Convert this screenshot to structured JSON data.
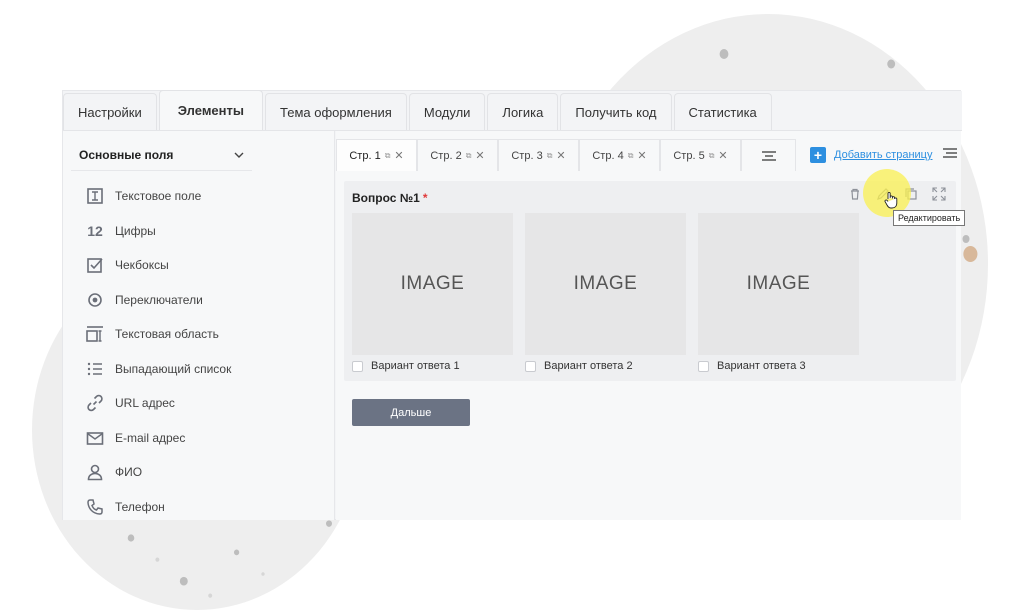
{
  "tabs": [
    "Настройки",
    "Элементы",
    "Тема оформления",
    "Модули",
    "Логика",
    "Получить код",
    "Статистика"
  ],
  "active_tab": "Элементы",
  "sidebar": {
    "section_title": "Основные поля",
    "fields": [
      {
        "label": "Текстовое поле",
        "icon": "text-field-icon"
      },
      {
        "label": "Цифры",
        "icon": "numbers-icon",
        "glyph": "12"
      },
      {
        "label": "Чекбоксы",
        "icon": "checkbox-icon"
      },
      {
        "label": "Переключатели",
        "icon": "radio-icon"
      },
      {
        "label": "Текстовая область",
        "icon": "textarea-icon"
      },
      {
        "label": "Выпадающий список",
        "icon": "dropdown-list-icon"
      },
      {
        "label": "URL адрес",
        "icon": "link-icon"
      },
      {
        "label": "E-mail адрес",
        "icon": "mail-icon"
      },
      {
        "label": "ФИО",
        "icon": "person-icon"
      },
      {
        "label": "Телефон",
        "icon": "phone-icon"
      }
    ]
  },
  "pages": [
    "Стр. 1",
    "Стр. 2",
    "Стр. 3",
    "Стр. 4",
    "Стр. 5"
  ],
  "active_page": "Стр. 1",
  "add_page_label": "Добавить страницу",
  "question": {
    "title": "Вопрос №1",
    "required_mark": "*",
    "tooltip": "Редактировать",
    "options": [
      {
        "image_text": "IMAGE",
        "label": "Вариант ответа 1"
      },
      {
        "image_text": "IMAGE",
        "label": "Вариант ответа 2"
      },
      {
        "image_text": "IMAGE",
        "label": "Вариант ответа 3"
      }
    ]
  },
  "next_button": "Дальше",
  "colors": {
    "accent": "#2d8fe0",
    "button": "#6b7384",
    "required": "#e03a3a"
  }
}
